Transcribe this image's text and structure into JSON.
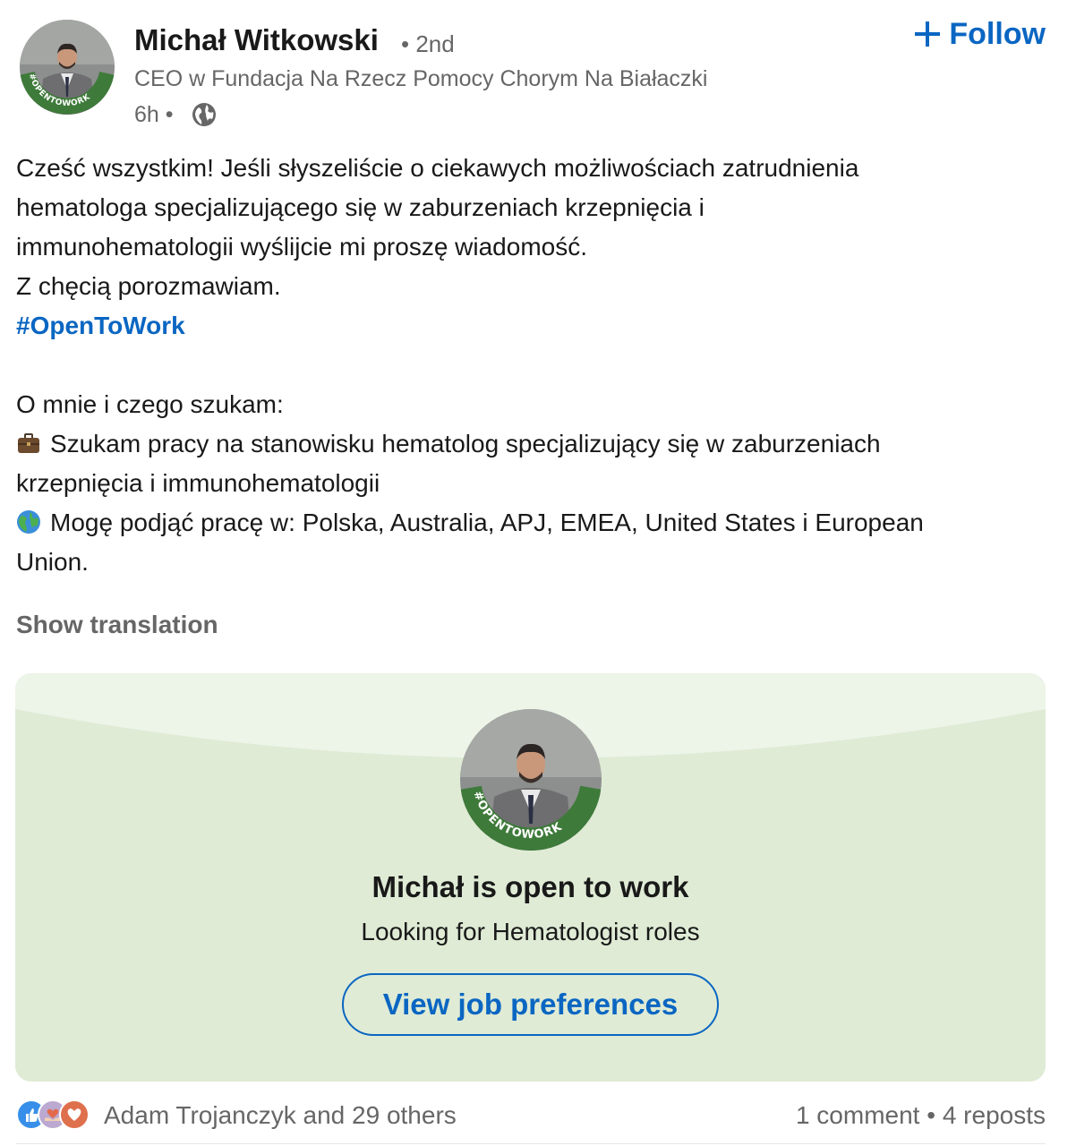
{
  "author": {
    "name": "Michał Witkowski",
    "degree": "• 2nd",
    "headline": "CEO w Fundacja Na Rzecz Pomocy Chorym Na Białaczki",
    "timestamp": "6h •",
    "avatar_badge": "#OPENTOWORK"
  },
  "follow": {
    "label": "Follow",
    "icon": "plus-icon"
  },
  "post": {
    "line1": "Cześć wszystkim! Jeśli słyszeliście o ciekawych możliwościach zatrudnienia",
    "line2": "hematologa specjalizującego się w zaburzeniach krzepnięcia i",
    "line3": "immunohematologii wyślijcie mi proszę wiadomość.",
    "line4": "Z chęcią porozmawiam.",
    "hashtag": "#OpenToWork",
    "line5": "O mnie i czego szukam:",
    "line6": "Szukam pracy na stanowisku hematolog specjalizujący się w zaburzeniach",
    "line7": "krzepnięcia i immunohematologii",
    "line8": "Mogę podjąć pracę w: Polska, Australia, APJ, EMEA, United States i European",
    "line9": "Union.",
    "emoji1": "briefcase-icon",
    "emoji2": "globe-icon"
  },
  "show_translation": "Show translation",
  "open_to_work": {
    "title": "Michał is open to work",
    "subtitle": "Looking for Hematologist roles",
    "button": "View job preferences",
    "badge": "#OPENTOWORK",
    "accent": "#3e7a3a"
  },
  "social": {
    "reactors": "Adam Trojanczyk and 29 others",
    "comments": "1 comment",
    "separator": "•",
    "reposts": "4 reposts",
    "reaction_icons": [
      "like-icon",
      "support-icon",
      "love-icon"
    ]
  },
  "colors": {
    "link": "#0a66c2",
    "muted": "#666666",
    "text": "#191919",
    "card_bg": "#dfebd5"
  }
}
